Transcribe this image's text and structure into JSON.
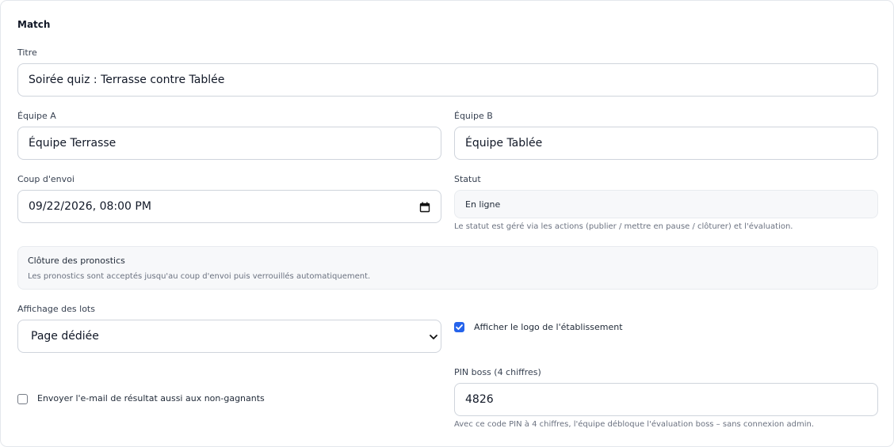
{
  "section": {
    "title": "Match"
  },
  "fields": {
    "title": {
      "label": "Titre",
      "value": "Soirée quiz : Terrasse contre Tablée"
    },
    "team_a": {
      "label": "Équipe A",
      "value": "Équipe Terrasse"
    },
    "team_b": {
      "label": "Équipe B",
      "value": "Équipe Tablée"
    },
    "kickoff": {
      "label": "Coup d'envoi",
      "value": "09/22/2026, 08:00 PM",
      "icon": "calendar-icon"
    },
    "status": {
      "label": "Statut",
      "value": "En ligne",
      "hint": "Le statut est géré via les actions (publier / mettre en pause / clôturer) et l'évaluation."
    },
    "prediction_close": {
      "title": "Clôture des pronostics",
      "text": "Les pronostics sont acceptés jusqu'au coup d'envoi puis verrouillés automatiquement."
    },
    "prizes_display": {
      "label": "Affichage des lots",
      "value": "Page dédiée",
      "icon": "chevron-down-icon"
    },
    "show_logo": {
      "label": "Afficher le logo de l'établissement",
      "checked": true
    },
    "email_losers": {
      "label": "Envoyer l'e-mail de résultat aussi aux non-gagnants",
      "checked": false
    },
    "boss_pin": {
      "label": "PIN boss (4 chiffres)",
      "value": "4826",
      "hint": "Avec ce code PIN à 4 chiffres, l'équipe débloque l'évaluation boss – sans connexion admin."
    }
  },
  "colors": {
    "accent": "#2563eb",
    "border": "#cfd4dc",
    "muted": "#6b7280",
    "readonly_bg": "#f7f8fa"
  }
}
